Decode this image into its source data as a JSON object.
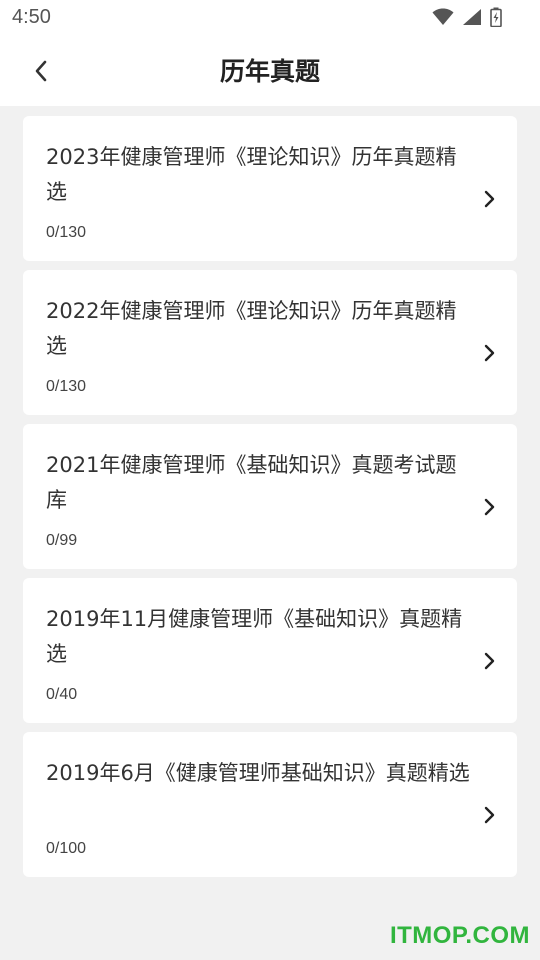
{
  "status": {
    "time": "4:50",
    "icons": [
      "wifi-icon",
      "signal-icon",
      "battery-icon"
    ]
  },
  "header": {
    "title": "历年真题",
    "back_icon": "chevron-left-icon"
  },
  "items": [
    {
      "title": "2023年健康管理师《理论知识》历年真题精选",
      "progress": "0/130"
    },
    {
      "title": "2022年健康管理师《理论知识》历年真题精选",
      "progress": "0/130"
    },
    {
      "title": "2021年健康管理师《基础知识》真题考试题库",
      "progress": "0/99"
    },
    {
      "title": "2019年11月健康管理师《基础知识》真题精选",
      "progress": "0/40"
    },
    {
      "title": "2019年6月《健康管理师基础知识》真题精选",
      "progress": "0/100"
    }
  ],
  "watermark": "ITMOP.COM",
  "colors": {
    "background": "#f1f1f1",
    "card": "#ffffff",
    "watermark": "#31b53e"
  }
}
